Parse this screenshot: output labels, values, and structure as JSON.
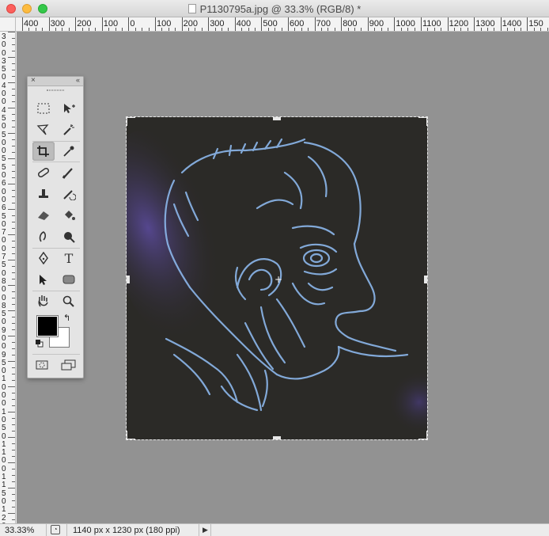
{
  "window": {
    "title": "P1130795a.jpg @ 33.3% (RGB/8) *"
  },
  "ruler_top": {
    "labels": [
      "400",
      "300",
      "200",
      "100",
      "0",
      "100",
      "200",
      "300",
      "400",
      "500",
      "600",
      "700",
      "800",
      "900",
      "1000",
      "1100",
      "1200",
      "1300",
      "1400",
      "150"
    ]
  },
  "ruler_left": {
    "digits": "3 0 0 3 5 0 4 0 0 4 5 0 5 0 0 5 5 0 6 0 0 6 5 0 7 0 0 7 5 0 8 0 0 8 5 0 9 0 0 9 5 0 1 0 0 0 1 0 5 0 1 1 0 0 1 1 5 0 1 2 0 0"
  },
  "toolbox": {
    "close_glyph": "×",
    "collapse_glyph": "«",
    "tools": [
      {
        "name": "rectangular-marquee-tool"
      },
      {
        "name": "move-tool"
      },
      {
        "name": "polygonal-lasso-tool"
      },
      {
        "name": "magic-wand-tool"
      },
      {
        "name": "crop-tool",
        "active": true
      },
      {
        "name": "eyedropper-tool"
      },
      {
        "name": "spot-healing-brush-tool"
      },
      {
        "name": "brush-tool"
      },
      {
        "name": "clone-stamp-tool"
      },
      {
        "name": "history-brush-tool"
      },
      {
        "name": "eraser-tool"
      },
      {
        "name": "paint-bucket-tool"
      },
      {
        "name": "blur-tool"
      },
      {
        "name": "burn-tool"
      },
      {
        "name": "pen-tool"
      },
      {
        "name": "type-tool",
        "glyph": "T"
      },
      {
        "name": "path-selection-tool"
      },
      {
        "name": "rounded-rectangle-tool"
      },
      {
        "name": "hand-tool"
      },
      {
        "name": "zoom-tool"
      }
    ],
    "foreground_color": "#000000",
    "background_color": "#ffffff",
    "swap_glyph": "↰"
  },
  "status": {
    "zoom": "33.33%",
    "doc_info": "1140 px x 1230 px (180 ppi)",
    "arrow_glyph": "▶"
  },
  "colors": {
    "canvas_bg": "#929292",
    "line_art": "#8ab4e8",
    "image_bg": "#2a2826",
    "purple_glow": "#5a4a9a"
  }
}
